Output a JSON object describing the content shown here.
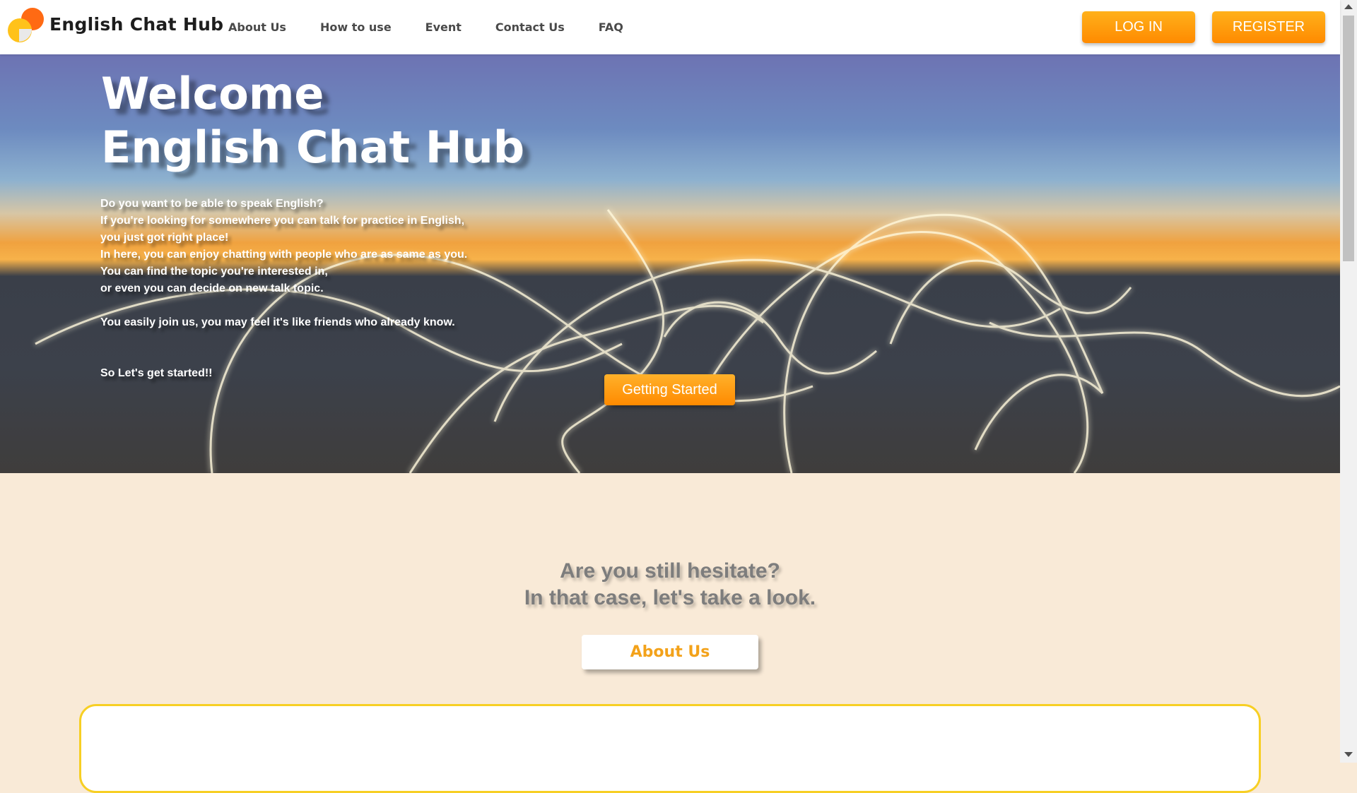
{
  "header": {
    "brand": "English Chat Hub",
    "nav": [
      "About Us",
      "How to use",
      "Event",
      "Contact Us",
      "FAQ"
    ],
    "login_label": "LOG IN",
    "register_label": "REGISTER"
  },
  "hero": {
    "title_line1": "Welcome",
    "title_line2": "English Chat Hub",
    "paragraphs": [
      "Do you want to be able to speak English?",
      "If you're looking for somewhere you can talk for practice in English,",
      "you just got right place!",
      "In here, you can enjoy chatting with people who are as same as you.",
      "You can find the topic you're interested in,",
      "or even you can decide on new talk topic."
    ],
    "paragraph2": "You easily join us, you may feel it's like friends who already know.",
    "paragraph3": "So Let's get started!!",
    "cta_label": "Getting Started"
  },
  "section": {
    "heading_line1": "Are you still hesitate?",
    "heading_line2": "In that case, let's take a look.",
    "about_label": "About Us"
  },
  "colors": {
    "accent": "#ff9a0e",
    "card_border": "#f7cf24",
    "section_bg": "#f9ead7"
  },
  "icons": [
    "logo-icon",
    "scroll-up-icon",
    "scroll-down-icon"
  ]
}
